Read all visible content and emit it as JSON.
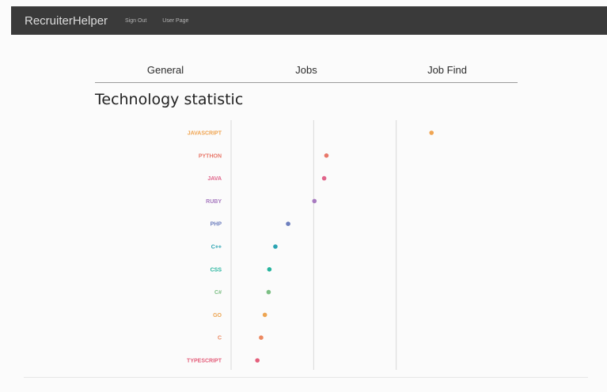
{
  "navbar": {
    "brand": "RecruiterHelper",
    "links": [
      "Sign Out",
      "User Page"
    ]
  },
  "tabs": [
    "General",
    "Jobs",
    "Job Find"
  ],
  "page_title": "Technology statistic",
  "chart_data": {
    "type": "lollipop",
    "orientation": "horizontal",
    "categories": [
      "JAVASCRIPT",
      "PYTHON",
      "JAVA",
      "RUBY",
      "PHP",
      "C++",
      "CSS",
      "C#",
      "GO",
      "C",
      "TYPESCRIPT"
    ],
    "values": [
      267,
      127,
      124,
      111,
      76,
      59,
      51,
      50,
      45,
      40,
      35
    ],
    "colors": [
      "#f0a552",
      "#e8786a",
      "#e0648a",
      "#a87bc0",
      "#6d7fbe",
      "#2aa3b2",
      "#27b59e",
      "#7cbf84",
      "#eda552",
      "#ec8860",
      "#e4607c"
    ],
    "xlim": [
      0,
      330
    ],
    "grid": true,
    "title": "",
    "xlabel": "",
    "ylabel": ""
  }
}
